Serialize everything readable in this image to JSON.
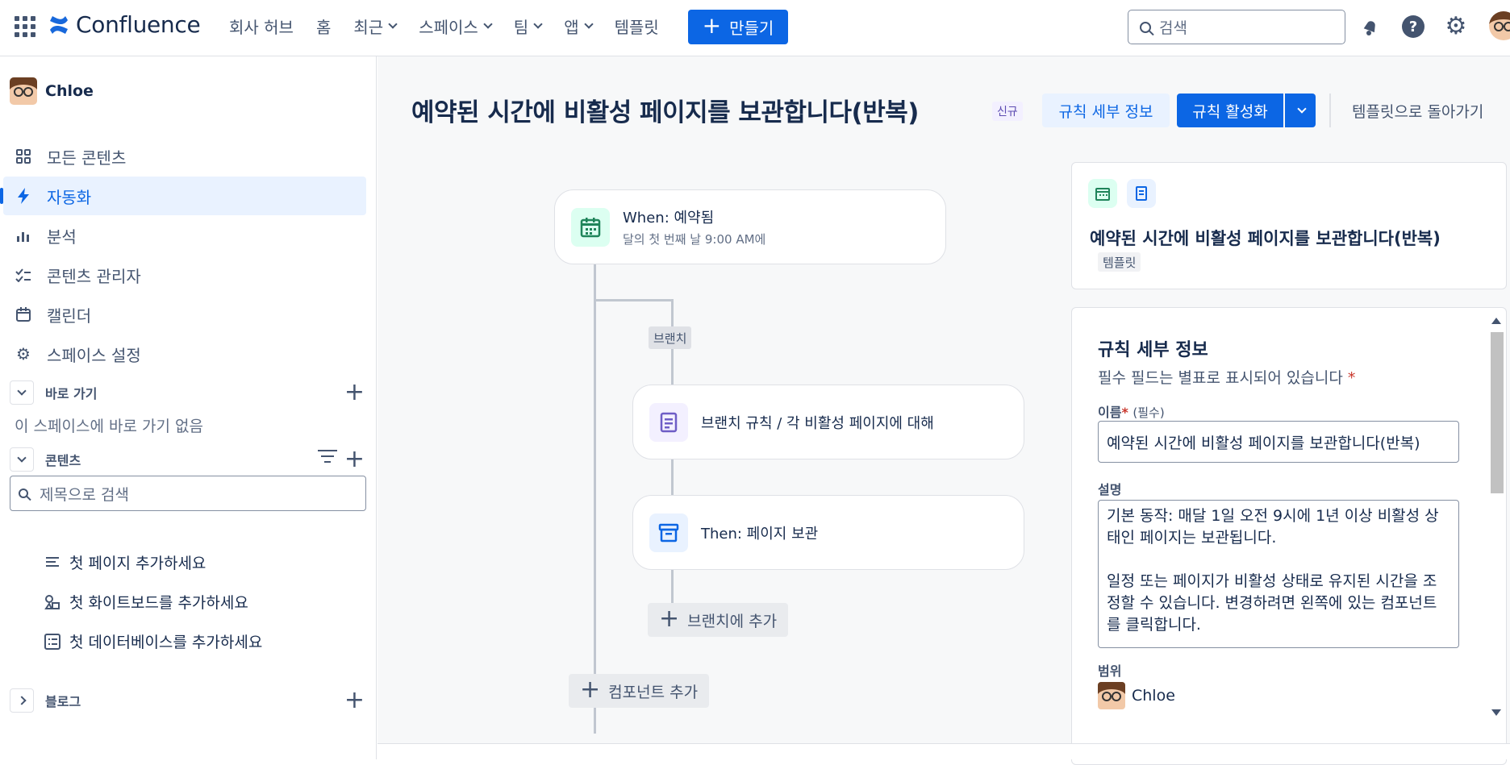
{
  "app": {
    "name": "Confluence",
    "colors": {
      "primary": "#0c66e4",
      "text": "#172b4d",
      "subtle": "#44546f",
      "canvas": "#f7f8f9"
    }
  },
  "topnav": {
    "items": [
      "회사 허브",
      "홈",
      "최근",
      "스페이스",
      "팀",
      "앱",
      "템플릿"
    ],
    "create_label": "만들기",
    "search_placeholder": "검색"
  },
  "sidebar": {
    "space_name": "Chloe",
    "items": [
      {
        "label": "모든 콘텐츠",
        "icon": "grid-icon"
      },
      {
        "label": "자동화",
        "icon": "lightning-icon"
      },
      {
        "label": "분석",
        "icon": "bar-chart-icon"
      },
      {
        "label": "콘텐츠 관리자",
        "icon": "checklist-icon"
      },
      {
        "label": "캘린더",
        "icon": "calendar-icon"
      },
      {
        "label": "스페이스 설정",
        "icon": "gear-icon"
      }
    ],
    "shortcuts_title": "바로 가기",
    "shortcuts_empty": "이 스페이스에 바로 가기 없음",
    "content_title": "콘텐츠",
    "content_search_placeholder": "제목으로 검색",
    "content_items": [
      {
        "label": "첫 페이지 추가하세요",
        "icon": "page-icon"
      },
      {
        "label": "첫 화이트보드를 추가하세요",
        "icon": "whiteboard-icon"
      },
      {
        "label": "첫 데이터베이스를 추가하세요",
        "icon": "database-icon"
      }
    ],
    "blog_title": "블로그"
  },
  "page": {
    "title": "예약된 시간에 비활성 페이지를 보관합니다(반복)",
    "new_badge": "신규",
    "rule_details_btn": "규칙 세부 정보",
    "enable_btn": "규칙 활성화",
    "back_link": "템플릿으로 돌아가기"
  },
  "flow": {
    "trigger_title": "When: 예약됨",
    "trigger_sub": "달의 첫 번째 날 9:00 AM에",
    "branch_tag": "브랜치",
    "branch_rule": "브랜치 규칙 / 각 비활성 페이지에 대해",
    "action": "Then: 페이지 보관",
    "add_to_branch": "브랜치에 추가",
    "add_component": "컴포넌트 추가"
  },
  "summary": {
    "title": "예약된 시간에 비활성 페이지를 보관합니다(반복)",
    "badge": "템플릿"
  },
  "details": {
    "heading": "규칙 세부 정보",
    "required_note": "필수 필드는 별표로 표시되어 있습니다",
    "required_mark": "*",
    "name_label": "이름",
    "name_required": "(필수)",
    "name_value": "예약된 시간에 비활성 페이지를 보관합니다(반복)",
    "desc_label": "설명",
    "desc_value": "기본 동작: 매달 1일 오전 9시에 1년 이상 비활성 상태인 페이지는 보관됩니다.\n\n일정 또는 페이지가 비활성 상태로 유지된 시간을 조정할 수 있습니다. 변경하려면 왼쪽에 있는 컴포넌트를 클릭합니다.",
    "scope_label": "범위",
    "scope_value": "Chloe"
  }
}
